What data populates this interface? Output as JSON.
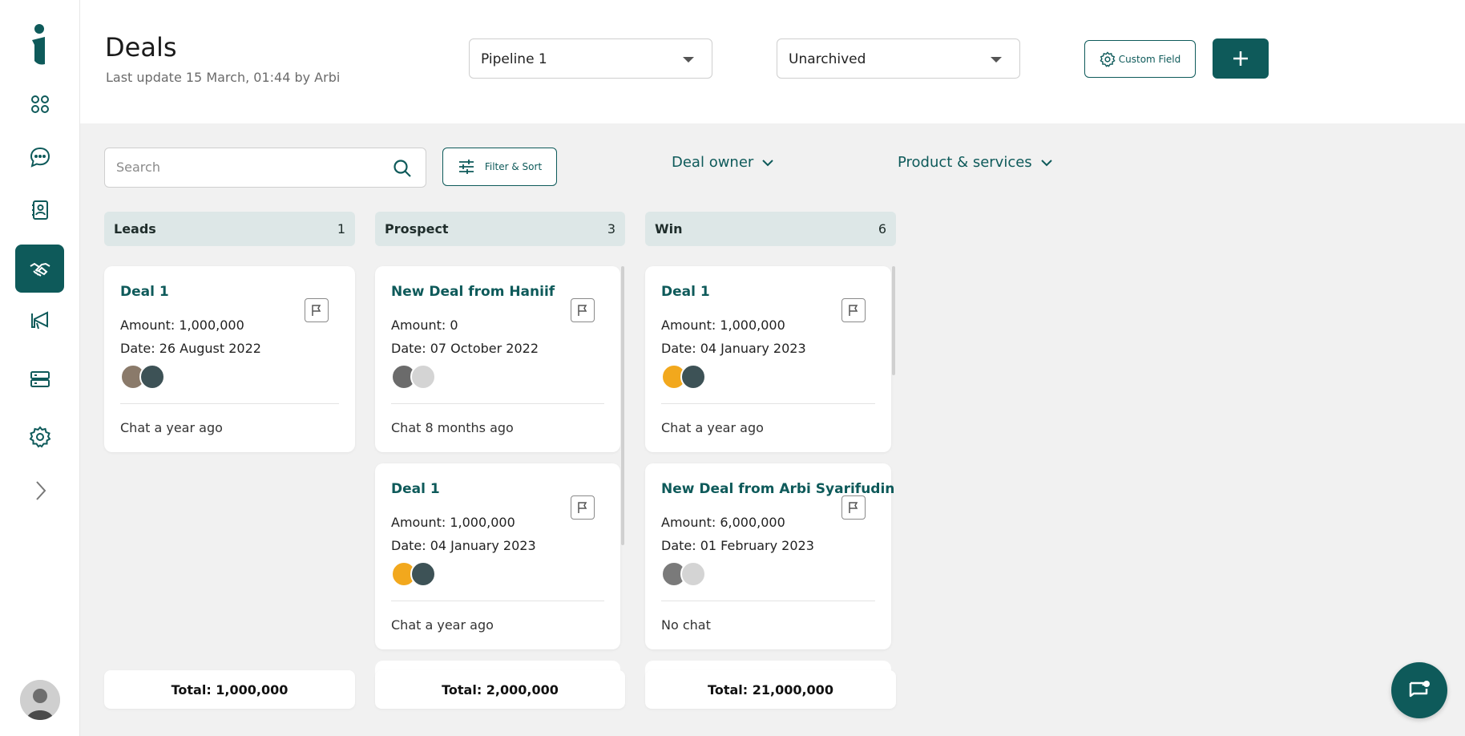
{
  "header": {
    "title": "Deals",
    "subtitle": "Last update 15 March, 01:44 by Arbi",
    "pipeline_select": "Pipeline 1",
    "archive_select": "Unarchived",
    "custom_field_label": "Custom Field",
    "add_label": "+"
  },
  "sidebar": {
    "items": [
      {
        "name": "dashboard",
        "icon": "grid-icon"
      },
      {
        "name": "chat",
        "icon": "chat-bubble-icon"
      },
      {
        "name": "contacts",
        "icon": "contact-book-icon"
      },
      {
        "name": "deals",
        "icon": "handshake-icon",
        "active": true
      },
      {
        "name": "campaigns",
        "icon": "megaphone-icon"
      },
      {
        "name": "storage",
        "icon": "server-icon"
      },
      {
        "name": "settings",
        "icon": "gear-icon"
      },
      {
        "name": "expand",
        "icon": "chevron-right-icon"
      }
    ]
  },
  "toolbar": {
    "search_placeholder": "Search",
    "filter_label": "Filter & Sort",
    "deal_owner_label": "Deal owner",
    "products_label": "Product & services"
  },
  "columns": [
    {
      "name": "Leads",
      "count": "1",
      "total": "Total: 1,000,000",
      "cards": [
        {
          "title": "Deal 1",
          "amount": "Amount: 1,000,000",
          "date": "Date: 26 August 2022",
          "chat": "Chat a year ago"
        }
      ]
    },
    {
      "name": "Prospect",
      "count": "3",
      "total": "Total: 2,000,000",
      "cards": [
        {
          "title": "New Deal from Haniif",
          "amount": "Amount: 0",
          "date": "Date: 07 October 2022",
          "chat": "Chat 8 months ago"
        },
        {
          "title": "Deal 1",
          "amount": "Amount: 1,000,000",
          "date": "Date: 04 January 2023",
          "chat": "Chat a year ago"
        }
      ]
    },
    {
      "name": "Win",
      "count": "6",
      "total": "Total: 21,000,000",
      "cards": [
        {
          "title": "Deal 1",
          "amount": "Amount: 1,000,000",
          "date": "Date: 04 January 2023",
          "chat": "Chat a year ago"
        },
        {
          "title": "New Deal from Arbi Syarifudin",
          "amount": "Amount: 6,000,000",
          "date": "Date: 01 February 2023",
          "chat": "No chat"
        }
      ]
    }
  ],
  "colors": {
    "primary": "#0e5a5a",
    "column_header_bg": "#dde7e7",
    "page_bg": "#f1f1f1"
  }
}
